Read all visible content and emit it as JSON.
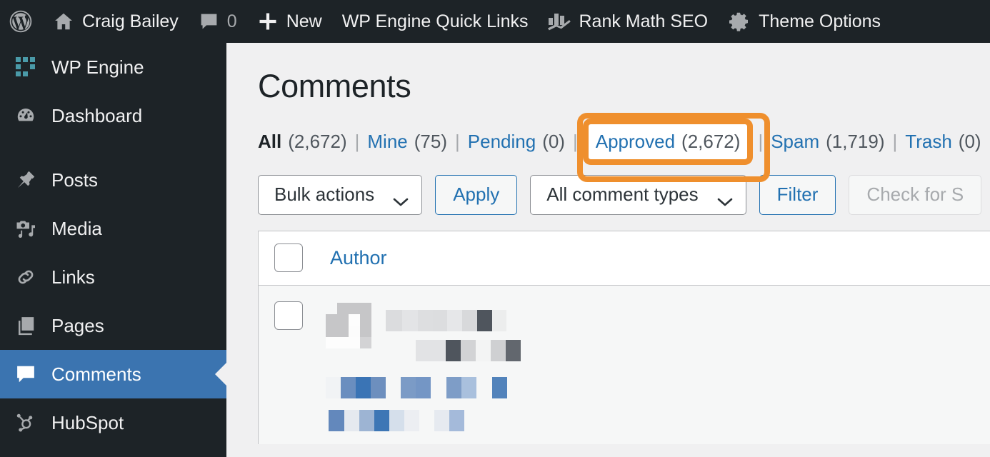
{
  "adminbar": {
    "items": [
      {
        "icon": "wordpress-logo-icon",
        "label": ""
      },
      {
        "icon": "home-icon",
        "label": "Craig Bailey"
      },
      {
        "icon": "comment-bubble-icon",
        "label": "0"
      },
      {
        "icon": "plus-icon",
        "label": "New"
      },
      {
        "icon": "",
        "label": "WP Engine Quick Links"
      },
      {
        "icon": "bar-chart-icon",
        "label": "Rank Math SEO"
      },
      {
        "icon": "gear-icon",
        "label": "Theme Options"
      }
    ]
  },
  "sidebar": {
    "items": [
      {
        "icon": "wpengine-grid-icon",
        "label": "WP Engine",
        "current": false
      },
      {
        "icon": "dashboard-gauge-icon",
        "label": "Dashboard",
        "current": false
      },
      {
        "icon": "pin-icon",
        "label": "Posts",
        "current": false
      },
      {
        "icon": "media-camera-icon",
        "label": "Media",
        "current": false
      },
      {
        "icon": "link-chain-icon",
        "label": "Links",
        "current": false
      },
      {
        "icon": "pages-stack-icon",
        "label": "Pages",
        "current": false
      },
      {
        "icon": "comment-bubble-icon",
        "label": "Comments",
        "current": true
      },
      {
        "icon": "hubspot-sprocket-icon",
        "label": "HubSpot",
        "current": false
      }
    ]
  },
  "main": {
    "title": "Comments",
    "filters": [
      {
        "label": "All",
        "count": "(2,672)",
        "current": true,
        "highlighted": false
      },
      {
        "label": "Mine",
        "count": "(75)",
        "current": false,
        "highlighted": false
      },
      {
        "label": "Pending",
        "count": "(0)",
        "current": false,
        "highlighted": false
      },
      {
        "label": "Approved",
        "count": "(2,672)",
        "current": false,
        "highlighted": true
      },
      {
        "label": "Spam",
        "count": "(1,719)",
        "current": false,
        "highlighted": false
      },
      {
        "label": "Trash",
        "count": "(0)",
        "current": false,
        "highlighted": false
      }
    ],
    "separator": "|",
    "toolbar": {
      "bulk_actions_label": "Bulk actions",
      "apply_label": "Apply",
      "comment_types_label": "All comment types",
      "filter_label": "Filter",
      "check_spam_label": "Check for S"
    },
    "table": {
      "columns": [
        "Author"
      ],
      "rows": [
        {
          "redacted": true
        }
      ]
    }
  },
  "colors": {
    "highlight_box": "#ef8f2d",
    "link": "#2271b1",
    "sidebar_bg": "#1d2327",
    "current_menu_bg": "#3b74b0",
    "content_bg": "#f0f0f1"
  }
}
